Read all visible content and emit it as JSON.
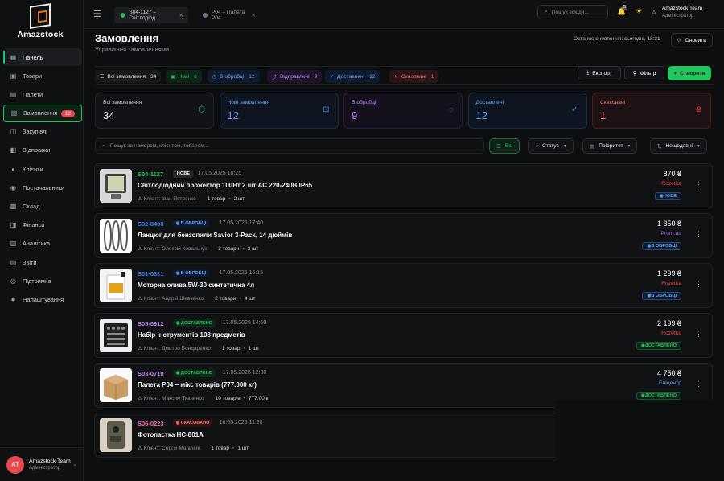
{
  "app": {
    "name": "Amazstock"
  },
  "sidebar": {
    "items": [
      {
        "label": "Панель",
        "icon": "grid-icon",
        "glyph": "▦"
      },
      {
        "label": "Товари",
        "icon": "box-icon",
        "glyph": "▣"
      },
      {
        "label": "Палети",
        "icon": "pallet-icon",
        "glyph": "▤"
      },
      {
        "label": "Замовлення",
        "icon": "cart-icon",
        "glyph": "▨",
        "badge": "12"
      },
      {
        "label": "Закупівлі",
        "icon": "bag-icon",
        "glyph": "◫"
      },
      {
        "label": "Відправки",
        "icon": "truck-icon",
        "glyph": "◧"
      },
      {
        "label": "Клієнти",
        "icon": "user-icon",
        "glyph": "●"
      },
      {
        "label": "Постачальники",
        "icon": "users-icon",
        "glyph": "◉"
      },
      {
        "label": "Склад",
        "icon": "warehouse-icon",
        "glyph": "▩"
      },
      {
        "label": "Фінанси",
        "icon": "money-icon",
        "glyph": "◨"
      },
      {
        "label": "Аналітика",
        "icon": "chart-icon",
        "glyph": "▥"
      },
      {
        "label": "Звіти",
        "icon": "report-icon",
        "glyph": "▧"
      },
      {
        "label": "Підтримка",
        "icon": "support-icon",
        "glyph": "◎"
      },
      {
        "label": "Налаштування",
        "icon": "gear-icon",
        "glyph": "✹"
      }
    ]
  },
  "user": {
    "initials": "AT",
    "name": "Amazstock Team",
    "role": "Адміністратор"
  },
  "topbar": {
    "tabs": [
      {
        "label": "S04-1127 – Світлодіод..."
      },
      {
        "label": "P04 – Палета P04"
      }
    ],
    "search_placeholder": "Пошук всюди...",
    "notification_count": "5"
  },
  "header": {
    "title": "Замовлення",
    "subtitle": "Управління замовленнями",
    "last_update": "Останнє оновлення: сьогодні, 18:31",
    "refresh": "Оновити"
  },
  "filters": [
    {
      "label": "Всі замовлення",
      "count": "34",
      "color": "#d6d8dc",
      "bg": "#16181b"
    },
    {
      "label": "Нові",
      "count": "6",
      "color": "#22c55e",
      "bg": "#0f2418"
    },
    {
      "label": "В обробці",
      "count": "12",
      "color": "#60a5fa",
      "bg": "#0f1a2e"
    },
    {
      "label": "Відправлені",
      "count": "9",
      "color": "#c084fc",
      "bg": "#1d1429"
    },
    {
      "label": "Доставлені",
      "count": "12",
      "color": "#60a5fa",
      "bg": "#0f1a2e"
    },
    {
      "label": "Скасовані",
      "count": "1",
      "color": "#f87171",
      "bg": "#2a1416"
    }
  ],
  "actions": {
    "export": "Експорт",
    "filter": "Фільтр",
    "create": "Створити"
  },
  "stats": [
    {
      "label": "Всі замовлення",
      "value": "34",
      "color": "#e6e7ea",
      "label_color": "#c9ccd1",
      "icon": "box-icon",
      "glyph": "⬡",
      "icolor": "#22c55e",
      "border": "#22252a",
      "bg": "#121316"
    },
    {
      "label": "Нові замовлення",
      "value": "12",
      "color": "#60a5fa",
      "label_color": "#60a5fa",
      "icon": "scan-icon",
      "glyph": "⊡",
      "icolor": "#3b82f6",
      "border": "#1c2a40",
      "bg": "#0f1520"
    },
    {
      "label": "В обробці",
      "value": "9",
      "color": "#c084fc",
      "label_color": "#c084fc",
      "icon": "spinner-icon",
      "glyph": "◌",
      "icolor": "#a855f7",
      "border": "#2a1d3d",
      "bg": "#15111c"
    },
    {
      "label": "Доставлені",
      "value": "12",
      "color": "#60a5fa",
      "label_color": "#60a5fa",
      "icon": "check-circle-icon",
      "glyph": "✓",
      "icolor": "#3b82f6",
      "border": "#1c2a40",
      "bg": "#0f1520"
    },
    {
      "label": "Скасовані",
      "value": "1",
      "color": "#f87171",
      "label_color": "#f87171",
      "icon": "x-circle-icon",
      "glyph": "⊗",
      "icolor": "#ef4444",
      "border": "#4a1f22",
      "bg": "#1e1214"
    }
  ],
  "toolbar": {
    "search_placeholder": "Пошук за номером, клієнтом, товаром...",
    "all": "Всі",
    "status": "Статус",
    "priority": "Пріоритет",
    "sort": "Нещодавні"
  },
  "orders": [
    {
      "id": "S04-1127",
      "id_color": "#22c55e",
      "status": "НОВЕ",
      "status_color": "#e6e7ea",
      "status_bg": "#24262a",
      "date": "17.05.2025 18:25",
      "title": "Світлодіодний прожектор 100Вт 2 шт AC 220-240В IP65",
      "client": "Клієнт: Іван Петренко",
      "items": "1 товар",
      "qty": "2 шт",
      "price": "870 ₴",
      "shop": "Rozetka",
      "shop_color": "#ef4444",
      "badge": "НОВЕ",
      "badge_color": "#60a5fa",
      "badge_bg": "#0f1a2e",
      "thumb": "projector"
    },
    {
      "id": "S02-0408",
      "id_color": "#3b82f6",
      "status": "В ОБРОБЦІ",
      "status_color": "#60a5fa",
      "status_bg": "#0f1a2e",
      "date": "17.05.2025 17:40",
      "title": "Ланцюг для бензопили Savior 3-Pack, 14 дюймів",
      "client": "Клієнт: Олексій Ковальчук",
      "items": "3 товари",
      "qty": "3 шт",
      "price": "1 350 ₴",
      "shop": "Prom.ua",
      "shop_color": "#a855f7",
      "badge": "В ОБРОБЦІ",
      "badge_color": "#60a5fa",
      "badge_bg": "#0f1a2e",
      "thumb": "chain"
    },
    {
      "id": "S01-0321",
      "id_color": "#3b82f6",
      "status": "В ОБРОБЦІ",
      "status_color": "#60a5fa",
      "status_bg": "#0f1a2e",
      "date": "17.05.2025 16:15",
      "title": "Моторна олива 5W-30 синтетична 4л",
      "client": "Клієнт: Андрій Шевченко",
      "items": "2 товари",
      "qty": "4 шт",
      "price": "1 299 ₴",
      "shop": "Rozetka",
      "shop_color": "#ef4444",
      "badge": "В ОБРОБЦІ",
      "badge_color": "#60a5fa",
      "badge_bg": "#0f1a2e",
      "thumb": "oil"
    },
    {
      "id": "S05-0912",
      "id_color": "#c084fc",
      "status": "ДОСТАВЛЕНО",
      "status_color": "#22c55e",
      "status_bg": "#0f2418",
      "date": "17.05.2025 14:50",
      "title": "Набір інструментів 108 предметів",
      "client": "Клієнт: Дмитро Бондаренко",
      "items": "1 товар",
      "qty": "1 шт",
      "price": "2 199 ₴",
      "shop": "Rozetka",
      "shop_color": "#ef4444",
      "badge": "ДОСТАВЛЕНО",
      "badge_color": "#22c55e",
      "badge_bg": "#0f2418",
      "thumb": "tools"
    },
    {
      "id": "S03-0710",
      "id_color": "#c084fc",
      "status": "ДОСТАВЛЕНО",
      "status_color": "#22c55e",
      "status_bg": "#0f2418",
      "date": "17.05.2025 12:30",
      "title": "Палета P04 – мікс товарів (777.000 кг)",
      "client": "Клієнт: Максим Ткаченко",
      "items": "10 товарів",
      "qty": "777.00 кг",
      "price": "4 750 ₴",
      "shop": "Епіцентр",
      "shop_color": "#60a5fa",
      "badge": "ДОСТАВЛЕНО",
      "badge_color": "#22c55e",
      "badge_bg": "#0f2418",
      "thumb": "boxitem"
    },
    {
      "id": "S06-0223",
      "id_color": "#f472b6",
      "status": "СКАСОВАНО",
      "status_color": "#f87171",
      "status_bg": "#2a1416",
      "date": "16.05.2025 11:20",
      "title": "Фотопастка HC-801A",
      "client": "Клієнт: Сергій Мельник",
      "items": "1 товар",
      "qty": "1 шт",
      "price": "",
      "shop": "",
      "shop_color": "#ef4444",
      "badge": "",
      "badge_color": "#ef4444",
      "badge_bg": "#2a1416",
      "thumb": "camera"
    }
  ]
}
